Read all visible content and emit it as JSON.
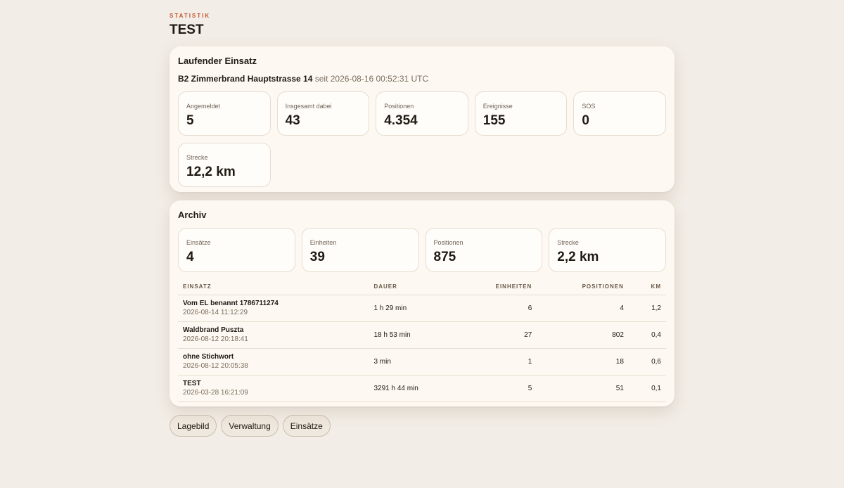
{
  "header": {
    "kicker": "STATISTIK",
    "title": "TEST"
  },
  "live": {
    "title": "Laufender Einsatz",
    "incident": "B2 Zimmerbrand Hauptstrasse 14",
    "since": "seit 2026-08-16 00:52:31 UTC",
    "stats": [
      {
        "label": "Angemeldet",
        "value": "5"
      },
      {
        "label": "Insgesamt dabei",
        "value": "43"
      },
      {
        "label": "Positionen",
        "value": "4.354"
      },
      {
        "label": "Ereignisse",
        "value": "155"
      },
      {
        "label": "SOS",
        "value": "0"
      },
      {
        "label": "Strecke",
        "value": "12,2 km"
      }
    ]
  },
  "archive": {
    "title": "Archiv",
    "stats": [
      {
        "label": "Einsätze",
        "value": "4"
      },
      {
        "label": "Einheiten",
        "value": "39"
      },
      {
        "label": "Positionen",
        "value": "875"
      },
      {
        "label": "Strecke",
        "value": "2,2 km"
      }
    ],
    "columns": [
      "EINSATZ",
      "DAUER",
      "EINHEITEN",
      "POSITIONEN",
      "KM"
    ],
    "rows": [
      {
        "name": "Vom EL benannt 1786711274",
        "date": "2026-08-14 11:12:29",
        "duration": "1 h 29 min",
        "units": "6",
        "positions": "4",
        "km": "1,2"
      },
      {
        "name": "Waldbrand Puszta",
        "date": "2026-08-12 20:18:41",
        "duration": "18 h 53 min",
        "units": "27",
        "positions": "802",
        "km": "0,4"
      },
      {
        "name": "ohne Stichwort",
        "date": "2026-08-12 20:05:38",
        "duration": "3 min",
        "units": "1",
        "positions": "18",
        "km": "0,6"
      },
      {
        "name": "TEST",
        "date": "2026-03-28 16:21:09",
        "duration": "3291 h 44 min",
        "units": "5",
        "positions": "51",
        "km": "0,1"
      }
    ]
  },
  "nav": {
    "lagebild": "Lagebild",
    "verwaltung": "Verwaltung",
    "einsaetze": "Einsätze"
  },
  "colors": {
    "background": "#f2ede6",
    "card": "#fdf8f1",
    "accent": "#c4532c"
  }
}
